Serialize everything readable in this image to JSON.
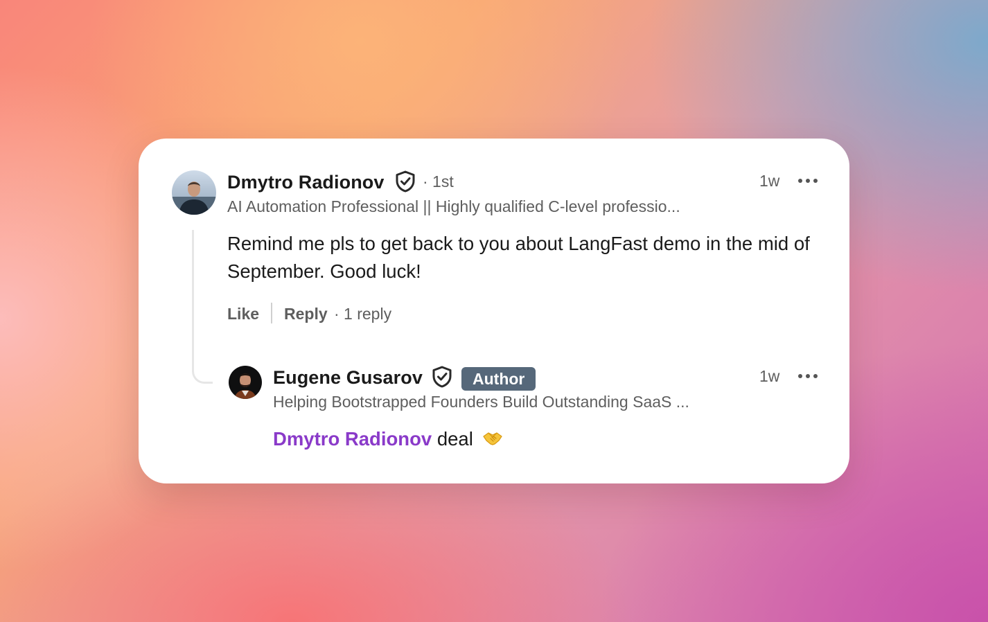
{
  "comment": {
    "author": "Dmytro Radionov",
    "connection": "· 1st",
    "headline": "AI Automation Professional || Highly qualified C-level professio...",
    "time": "1w",
    "text": "Remind me pls to get back to you about LangFast demo in the mid of September. Good luck!",
    "like_label": "Like",
    "reply_label": "Reply",
    "replies_count": "· 1 reply"
  },
  "reply": {
    "author": "Eugene Gusarov",
    "badge": "Author",
    "headline": "Helping Bootstrapped Founders Build Outstanding SaaS ...",
    "time": "1w",
    "mention": "Dmytro Radionov",
    "text": "deal"
  },
  "icons": {
    "verified": "shield-check-icon",
    "more": "more-horizontal-icon",
    "emoji": "handshake-emoji"
  },
  "colors": {
    "mention": "#8a3ac9",
    "badge_bg": "#56687a"
  }
}
